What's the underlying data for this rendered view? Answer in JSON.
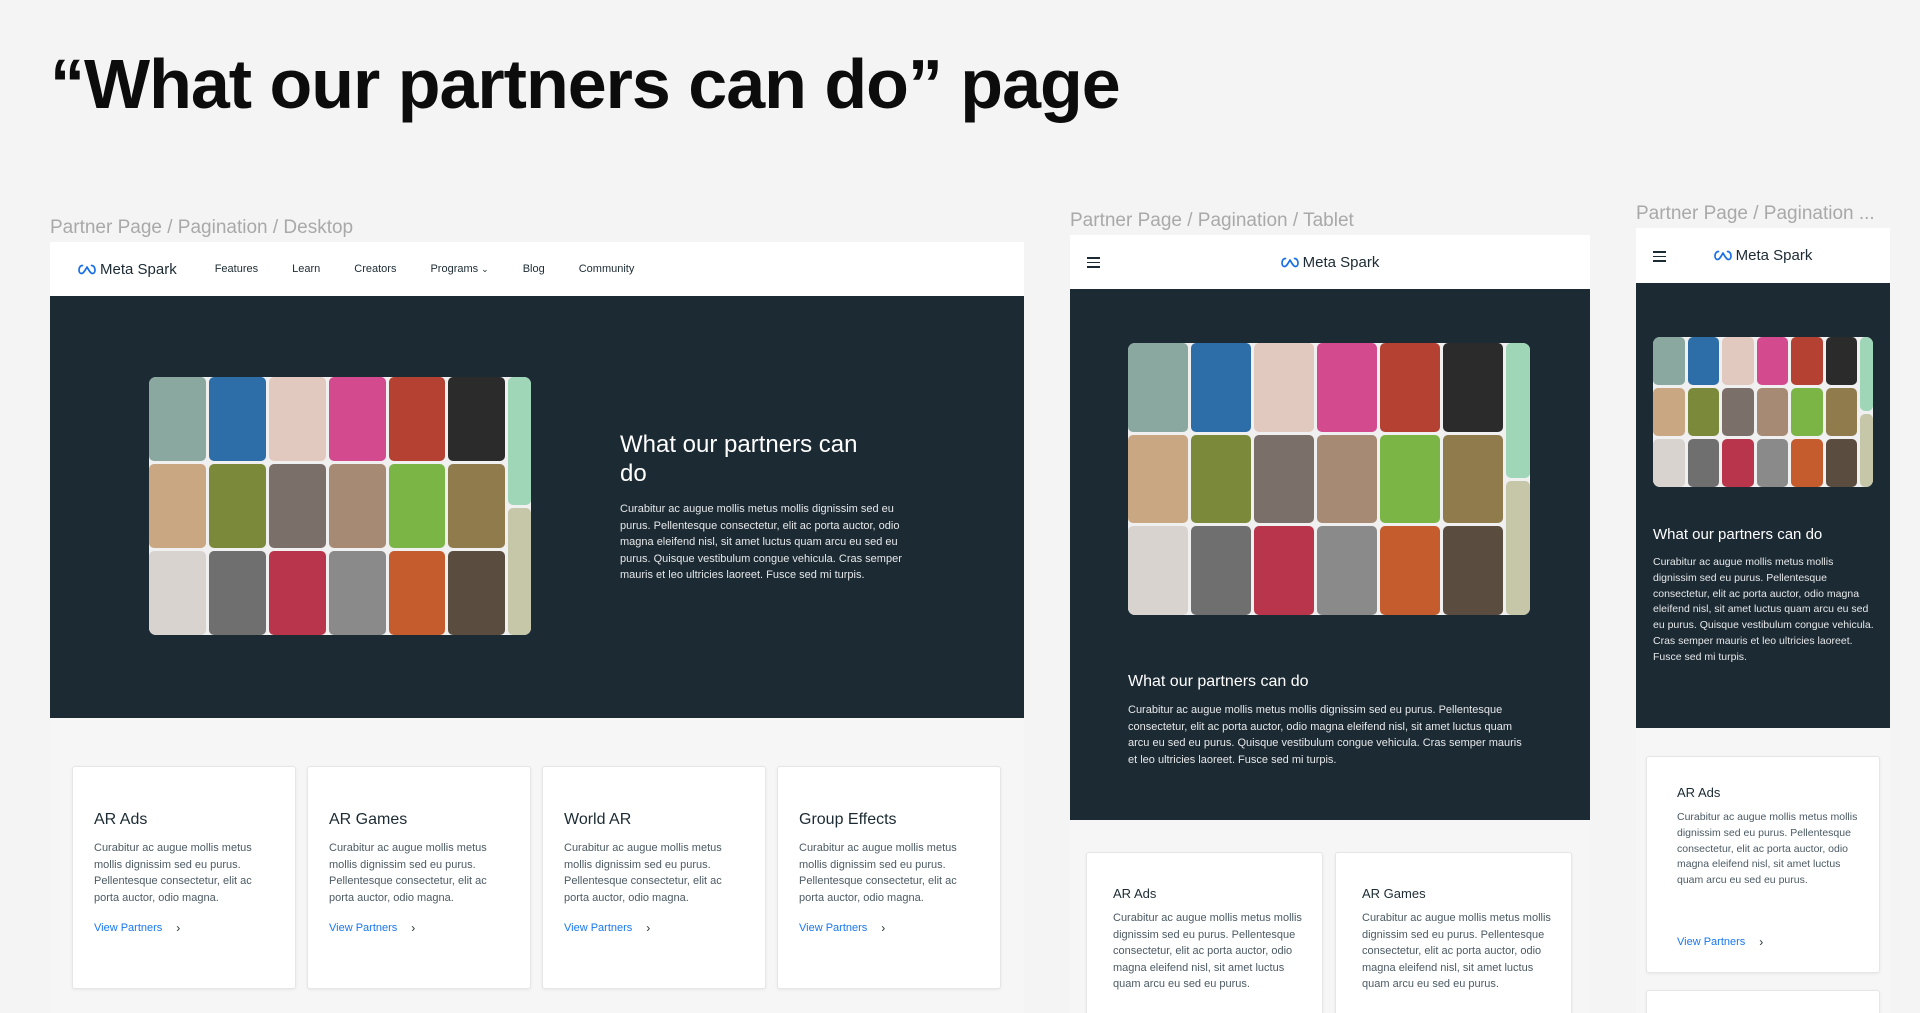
{
  "page_title": "“What our partners can do” page",
  "frames": {
    "desktop_label": "Partner Page / Pagination / Desktop",
    "tablet_label": "Partner Page / Pagination / Tablet",
    "mobile_label": "Partner Page / Pagination ..."
  },
  "brand": {
    "name": "Meta Spark",
    "icon": "meta-infinity-logo"
  },
  "nav": {
    "features": "Features",
    "learn": "Learn",
    "creators": "Creators",
    "programs": "Programs",
    "blog": "Blog",
    "community": "Community"
  },
  "hero": {
    "title": "What our partners can do",
    "body": "Curabitur ac augue mollis metus mollis dignissim sed eu purus. Pellentesque consectetur, elit ac porta auctor, odio magna eleifend nisl, sit amet luctus quam arcu eu sed eu purus. Quisque vestibulum congue vehicula. Cras semper mauris et leo ultricies laoreet. Fusce sed mi turpis."
  },
  "cards": [
    {
      "title": "AR Ads",
      "body": "Curabitur ac augue mollis metus mollis dignissim sed eu purus. Pellentesque consectetur, elit ac porta auctor, odio magna.",
      "link": "View Partners"
    },
    {
      "title": "AR Games",
      "body": "Curabitur ac augue mollis metus mollis dignissim sed eu purus. Pellentesque consectetur, elit ac porta auctor, odio magna.",
      "link": "View Partners"
    },
    {
      "title": "World AR",
      "body": "Curabitur ac augue mollis metus mollis dignissim sed eu purus. Pellentesque consectetur, elit ac porta auctor, odio magna.",
      "link": "View Partners"
    },
    {
      "title": "Group Effects",
      "body": "Curabitur ac augue mollis metus mollis dignissim sed eu purus. Pellentesque consectetur, elit ac porta auctor, odio magna.",
      "link": "View Partners"
    }
  ],
  "tablet_cards": [
    {
      "title": "AR Ads",
      "body": "Curabitur ac augue mollis metus mollis dignissim sed eu purus. Pellentesque consectetur, elit ac porta auctor, odio magna eleifend nisl, sit amet luctus quam arcu eu sed eu purus."
    },
    {
      "title": "AR Games",
      "body": "Curabitur ac augue mollis metus mollis dignissim sed eu purus. Pellentesque consectetur, elit ac porta auctor, odio magna eleifend nisl, sit amet luctus quam arcu eu sed eu purus."
    }
  ],
  "mobile_card": {
    "title": "AR Ads",
    "body": "Curabitur ac augue mollis metus mollis dignissim sed eu purus. Pellentesque consectetur, elit ac porta auctor, odio magna eleifend nisl, sit amet luctus quam arcu eu sed eu purus.",
    "link": "View Partners"
  },
  "colors": {
    "hero_bg": "#1c2a33",
    "link": "#1877f2",
    "text": "#1c2b33"
  }
}
